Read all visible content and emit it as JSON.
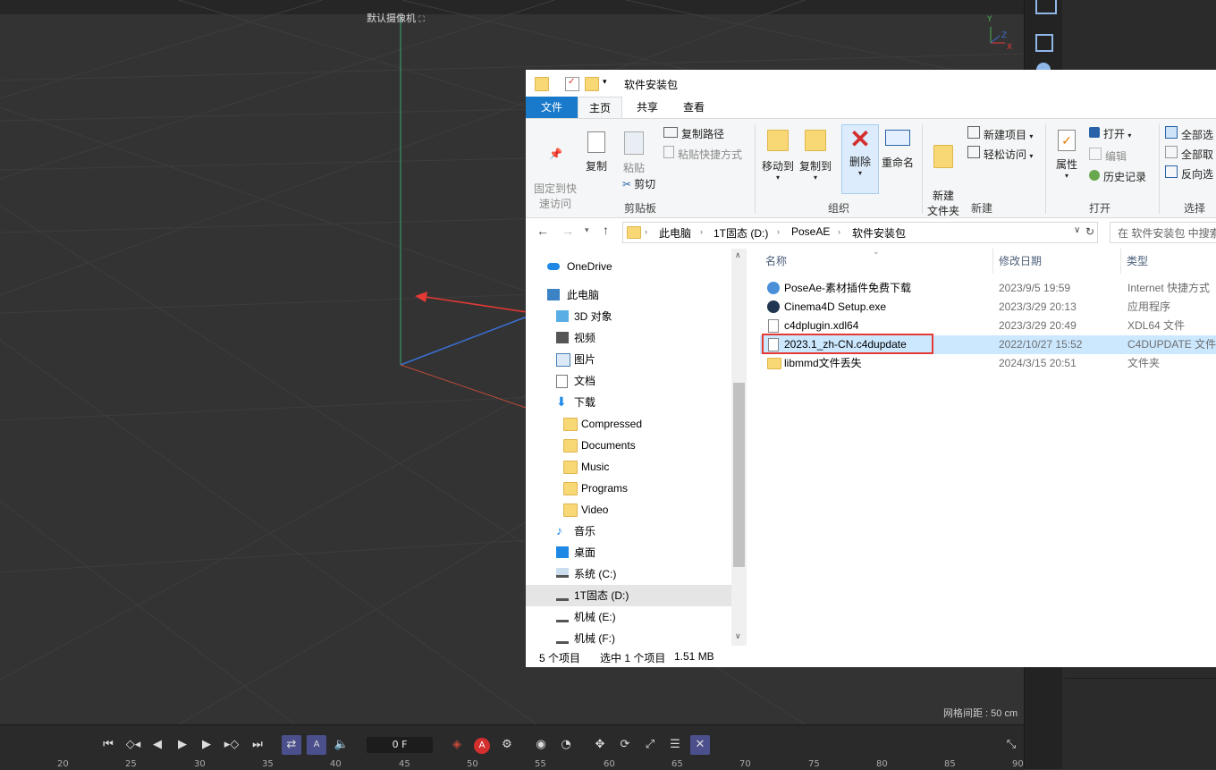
{
  "viewport": {
    "camera_label": "默认摄像机",
    "camera_icon": "camera-link-icon",
    "grid_spacing_text": "网格间距 : 50 cm",
    "axis_labels": {
      "y": "Y",
      "z": "Z",
      "x": "X"
    }
  },
  "timeline": {
    "frame_value": "0 F",
    "ruler_ticks": [
      "20",
      "25",
      "30",
      "35",
      "40",
      "45",
      "50",
      "55",
      "60",
      "65",
      "70",
      "75",
      "80",
      "85",
      "90"
    ],
    "record_label": "A"
  },
  "explorer": {
    "window_title": "软件安装包",
    "tabs": {
      "file": "文件",
      "home": "主页",
      "share": "共享",
      "view": "查看"
    },
    "ribbon": {
      "pin_quick_access": "固定到快\n速访问",
      "copy": "复制",
      "paste": "粘贴",
      "copy_path": "复制路径",
      "paste_shortcut": "粘贴快捷方式",
      "cut": "剪切",
      "clipboard_group": "剪贴板",
      "move_to": "移动到",
      "copy_to": "复制到",
      "delete": "删除",
      "rename": "重命名",
      "organize_group": "组织",
      "new_folder": "新建\n文件夹",
      "new_item": "新建项目",
      "easy_access": "轻松访问",
      "new_group": "新建",
      "properties": "属性",
      "open": "打开",
      "edit": "编辑",
      "history": "历史记录",
      "open_group": "打开",
      "select_all": "全部选",
      "select_none": "全部取",
      "invert_selection": "反向选",
      "select_group": "选择"
    },
    "address": {
      "segments": [
        "此电脑",
        "1T固态 (D:)",
        "PoseAE",
        "软件安装包"
      ],
      "search_placeholder": "在 软件安装包 中搜索"
    },
    "nav": [
      {
        "label": "OneDrive",
        "icon": "onedrive-icon"
      },
      {
        "label": "此电脑",
        "icon": "this-pc-icon"
      },
      {
        "label": "3D 对象",
        "icon": "3d-objects-icon"
      },
      {
        "label": "视频",
        "icon": "video-icon"
      },
      {
        "label": "图片",
        "icon": "pictures-icon"
      },
      {
        "label": "文档",
        "icon": "documents-icon"
      },
      {
        "label": "下载",
        "icon": "download-icon"
      },
      {
        "label": "Compressed",
        "icon": "folder-icon"
      },
      {
        "label": "Documents",
        "icon": "folder-icon"
      },
      {
        "label": "Music",
        "icon": "folder-icon"
      },
      {
        "label": "Programs",
        "icon": "folder-icon"
      },
      {
        "label": "Video",
        "icon": "folder-icon"
      },
      {
        "label": "音乐",
        "icon": "music-icon"
      },
      {
        "label": "桌面",
        "icon": "desktop-icon"
      },
      {
        "label": "系统 (C:)",
        "icon": "system-drive-icon"
      },
      {
        "label": "1T固态 (D:)",
        "icon": "drive-icon"
      },
      {
        "label": "机械 (E:)",
        "icon": "drive-icon"
      },
      {
        "label": "机械 (F:)",
        "icon": "drive-icon"
      }
    ],
    "columns": {
      "name": "名称",
      "date": "修改日期",
      "type": "类型"
    },
    "files": [
      {
        "name": "PoseAe-素材插件免费下载",
        "date": "2023/9/5 19:59",
        "type": "Internet 快捷方式",
        "icon": "internet-shortcut-icon"
      },
      {
        "name": "Cinema4D Setup.exe",
        "date": "2023/3/29 20:13",
        "type": "应用程序",
        "icon": "cinema4d-app-icon"
      },
      {
        "name": "c4dplugin.xdl64",
        "date": "2023/3/29 20:49",
        "type": "XDL64 文件",
        "icon": "file-icon"
      },
      {
        "name": "2023.1_zh-CN.c4dupdate",
        "date": "2022/10/27 15:52",
        "type": "C4DUPDATE 文件",
        "icon": "file-icon"
      },
      {
        "name": "libmmd文件丢失",
        "date": "2024/3/15 20:51",
        "type": "文件夹",
        "icon": "folder-icon"
      }
    ],
    "status": {
      "count": "5 个项目",
      "selected": "选中 1 个项目",
      "size": "1.51 MB"
    }
  },
  "colors": {
    "annotation_red": "#e53935",
    "selection_blue": "#cce8ff",
    "accent_blue": "#1979ca"
  }
}
